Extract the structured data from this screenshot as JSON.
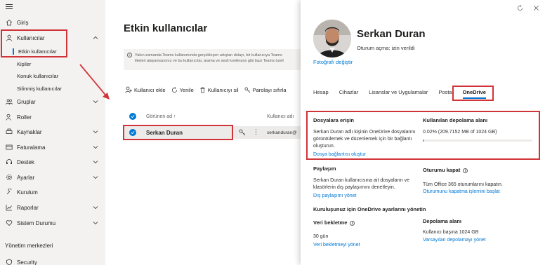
{
  "sidebar": {
    "home": "Giriş",
    "users": "Kullanıcılar",
    "active_users": "Etkin kullanıcılar",
    "contacts": "Kişiler",
    "guest_users": "Konuk kullanıcılar",
    "deleted_users": "Silinmiş kullanıcılar",
    "groups": "Gruplar",
    "roles": "Roller",
    "resources": "Kaynaklar",
    "billing": "Faturalama",
    "support": "Destek",
    "settings": "Ayarlar",
    "setup": "Kurulum",
    "reports": "Raporlar",
    "health": "Sistem Durumu",
    "admin_centers": "Yönetim merkezleri",
    "security": "Security"
  },
  "main": {
    "title": "Etkin kullanıcılar",
    "banner_line1": "Yakın zamanda Teams kullanımında gerçekleşen artıştan dolayı, bir kullanıcıya Teams",
    "banner_line2": "ilkeleri atayamazsınız ve bu kullanıcılar, arama ve sesli konferans gibi bazı Teams özell",
    "toolbar": {
      "add_user": "Kullanıcı ekle",
      "refresh": "Yenile",
      "delete_user": "Kullanıcıyı sil",
      "reset_password": "Parolayı sıfırla"
    },
    "col_display_name": "Görünen ad ↑",
    "col_username": "Kullanıcı adı",
    "row": {
      "name": "Serkan Duran",
      "username": "serkanduran@"
    }
  },
  "panel": {
    "name": "Serkan Duran",
    "sign_in": "Oturum açma: izin verildi",
    "change_photo": "Fotoğrafı değiştir",
    "tabs": [
      "Hesap",
      "Cihazlar",
      "Lisanslar ve Uygulamalar",
      "Posta",
      "OneDrive"
    ],
    "file_access": {
      "title": "Dosyalara erişin",
      "text1": "Serkan Duran adlı kişinin OneDrive dosyalarını",
      "text2": "görüntülemek ve düzenlemek için bir bağlantı",
      "text3": "oluşturun.",
      "link": "Dosya bağlantısı oluştur"
    },
    "storage_used": {
      "title": "Kullanılan depolama alanı",
      "value": "0.02% (209.7152 MB of 1024 GB)",
      "fraction": 0.0002
    },
    "sharing": {
      "title": "Paylaşım",
      "text1": "Serkan Duran kullanıcısına ait dosyaların ve",
      "text2": "klasörlerin dış paylaşımını denetleyin.",
      "link": "Dış paylaşımı yönet"
    },
    "sign_out": {
      "title": "Oturumu kapat",
      "text": "Tüm Office 365 oturumlarını kapatın.",
      "link": "Oturumunu kapatma işlemini başlat"
    },
    "org_settings_title": "Kuruluşunuz için OneDrive ayarlarını yönetin",
    "retention": {
      "title": "Veri bekletme",
      "value": "30 gün",
      "link": "Veri bekletmeyi yönet"
    },
    "storage_space": {
      "title": "Depolama alanı",
      "value": "Kullanıcı başına 1024 GB",
      "link": "Varsayılan depolamayı yönet"
    }
  },
  "colors": {
    "accent": "#0078d4",
    "highlight": "#d13438"
  }
}
